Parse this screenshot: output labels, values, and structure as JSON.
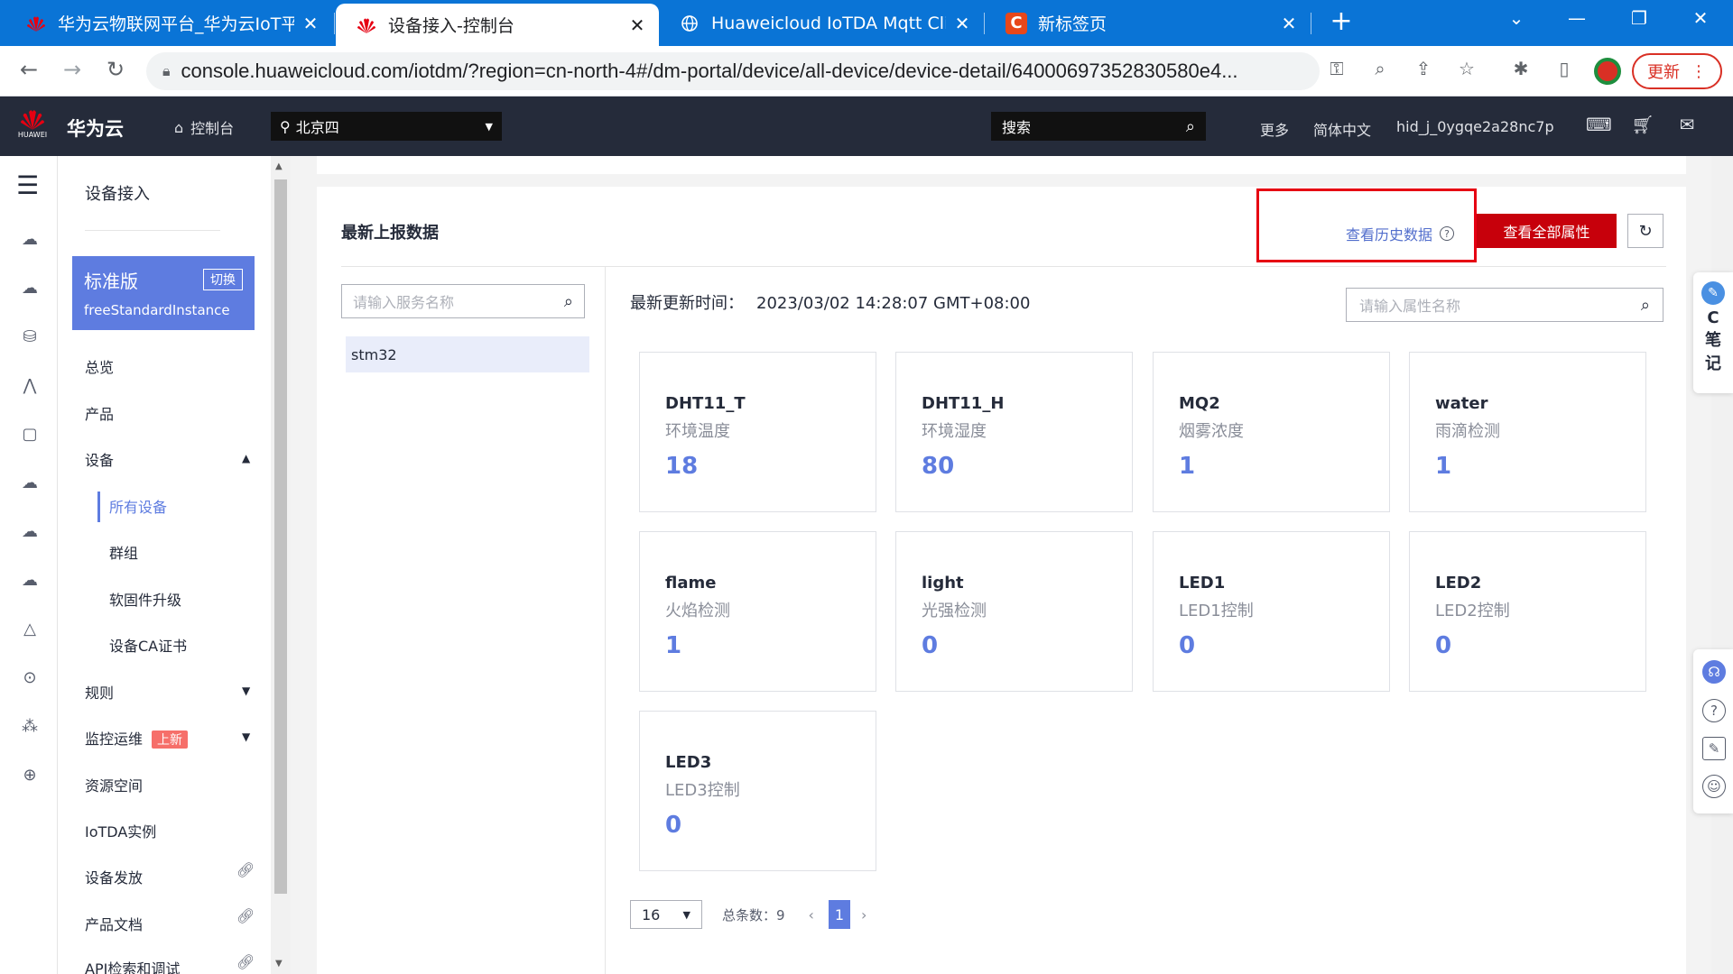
{
  "browser": {
    "tabs": [
      {
        "title": "华为云物联网平台_华为云IoT平台",
        "close": "✕"
      },
      {
        "title": "设备接入-控制台",
        "close": "✕"
      },
      {
        "title": "Huaweicloud IoTDA Mqtt Client",
        "close": "✕"
      },
      {
        "title": "新标签页",
        "close": "✕"
      }
    ],
    "new_tab": "+",
    "window_controls": [
      "⌄",
      "—",
      "❐",
      "✕"
    ],
    "url": "console.huaweicloud.com/iotdm/?region=cn-north-4#/dm-portal/device/all-device/device-detail/64000697352830580e4...",
    "update_label": "更新",
    "accent": "#0a74d6"
  },
  "header": {
    "brand": "华为云",
    "logo_text": "HUAWEI",
    "console": "控制台",
    "region": "北京四",
    "search_placeholder": "搜索",
    "more": "更多",
    "language": "简体中文",
    "username": "hid_j_0ygqe2a28nc7p"
  },
  "sidebar": {
    "title": "设备接入",
    "edition": {
      "name": "标准版",
      "switch": "切换",
      "instance": "freeStandardInstance"
    },
    "items": {
      "overview": "总览",
      "product": "产品",
      "device": "设备",
      "all_devices": "所有设备",
      "group": "群组",
      "firmware": "软固件升级",
      "ca_cert": "设备CA证书",
      "rules": "规则",
      "monitoring": "监控运维",
      "monitoring_badge": "上新",
      "resource_space": "资源空间",
      "iotda_instance": "IoTDA实例",
      "provisioning": "设备发放",
      "product_docs": "产品文档",
      "api_explorer": "API检索和调试"
    }
  },
  "main": {
    "title": "最新上报数据",
    "history_link": "查看历史数据",
    "all_props_button": "查看全部属性",
    "service_search_placeholder": "请输入服务名称",
    "services": [
      "stm32"
    ],
    "update_time_label": "最新更新时间：",
    "update_time": "2023/03/02 14:28:07 GMT+08:00",
    "property_search_placeholder": "请输入属性名称",
    "properties": [
      {
        "name": "DHT11_T",
        "desc": "环境温度",
        "value": "18"
      },
      {
        "name": "DHT11_H",
        "desc": "环境湿度",
        "value": "80"
      },
      {
        "name": "MQ2",
        "desc": "烟雾浓度",
        "value": "1"
      },
      {
        "name": "water",
        "desc": "雨滴检测",
        "value": "1"
      },
      {
        "name": "flame",
        "desc": "火焰检测",
        "value": "1"
      },
      {
        "name": "light",
        "desc": "光强检测",
        "value": "0"
      },
      {
        "name": "LED1",
        "desc": "LED1控制",
        "value": "0"
      },
      {
        "name": "LED2",
        "desc": "LED2控制",
        "value": "0"
      },
      {
        "name": "LED3",
        "desc": "LED3控制",
        "value": "0"
      }
    ],
    "pager": {
      "page_size": "16",
      "total": "总条数：9",
      "current_page": "1"
    },
    "value_color": "#5e7ce0",
    "highlight_color": "#e60012"
  },
  "right_tools": {
    "note": [
      "C",
      "笔",
      "记"
    ]
  }
}
